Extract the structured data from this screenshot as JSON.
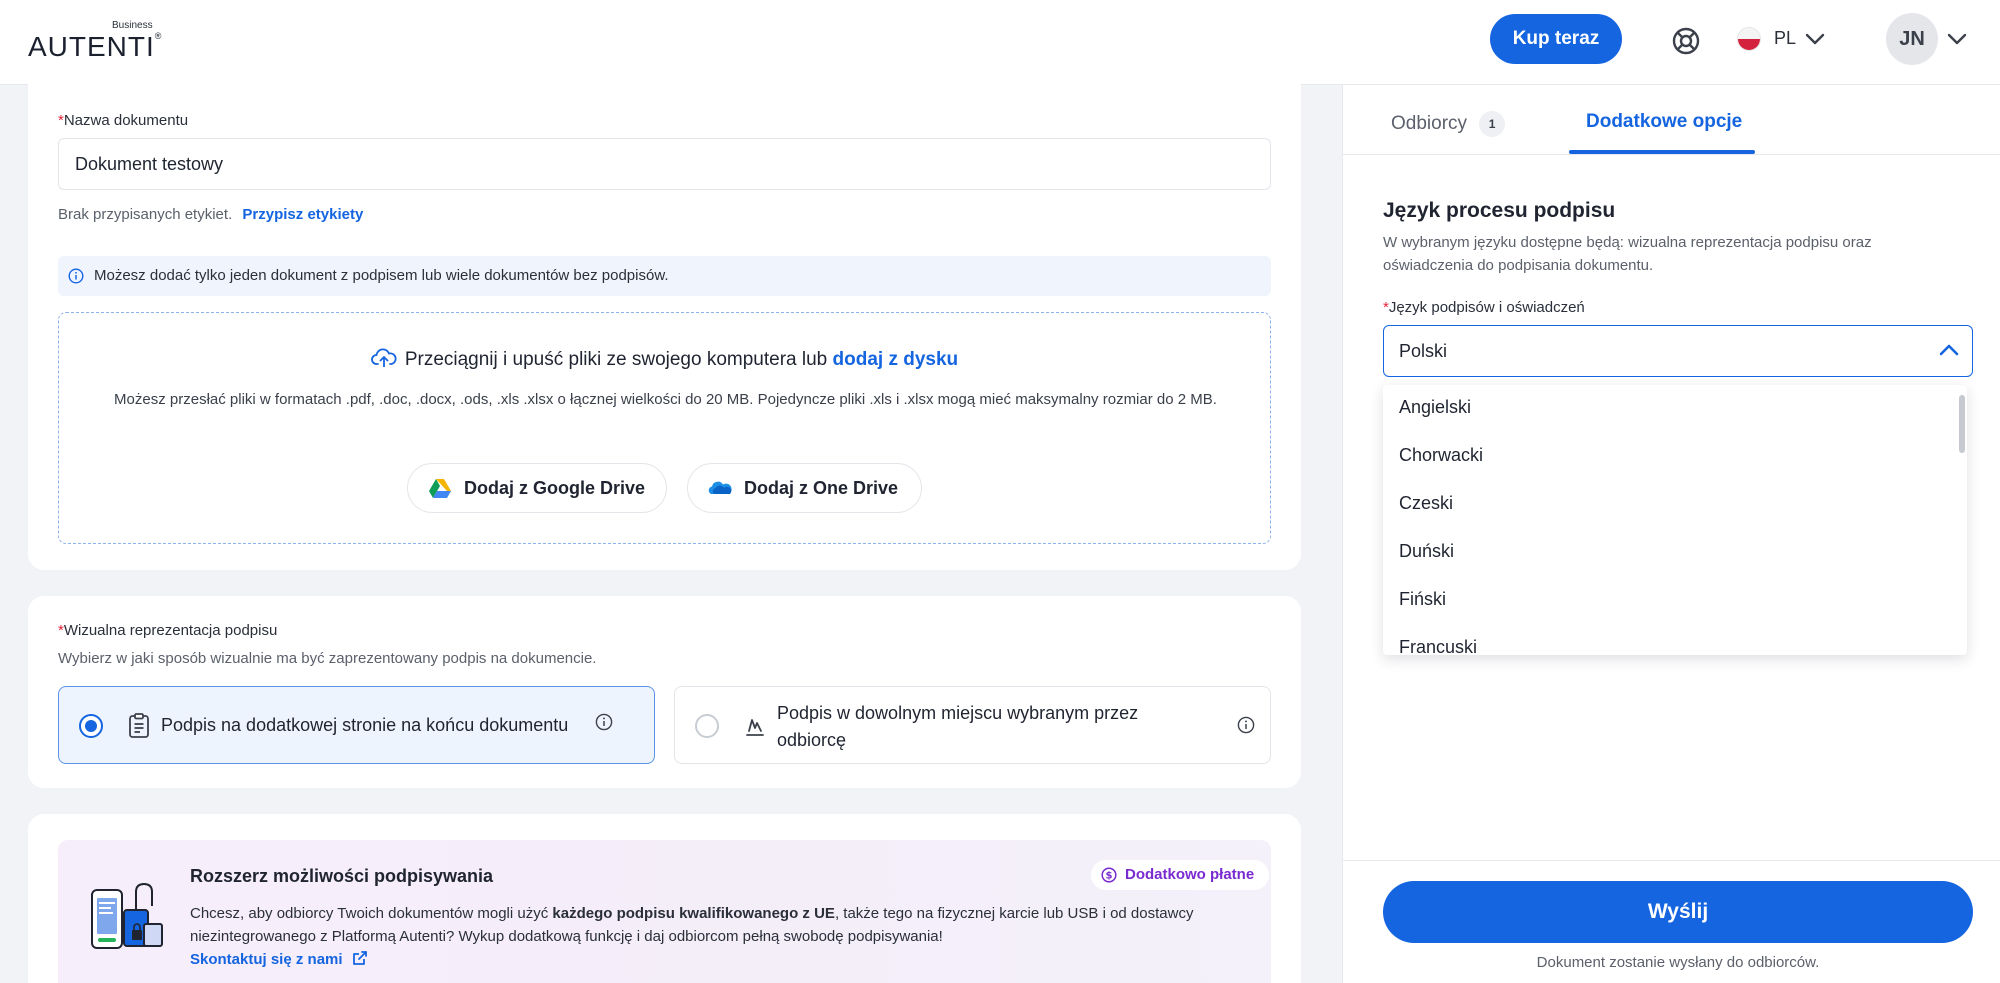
{
  "header": {
    "logo_business": "Business",
    "logo_text": "AUTENTI",
    "buy_label": "Kup teraz",
    "language": "PL",
    "user_initials": "JN"
  },
  "document": {
    "name_label": "Nazwa dokumentu",
    "name_value": "Dokument testowy",
    "no_labels_text": "Brak przypisanych etykiet.",
    "assign_labels_link": "Przypisz etykiety",
    "info_text": "Możesz dodać tylko jeden dokument z podpisem lub wiele dokumentów bez podpisów."
  },
  "upload": {
    "drag_text": "Przeciągnij i upuść pliki ze swojego komputera lub",
    "drag_link": "dodaj z dysku",
    "formats_text": "Możesz przesłać pliki w formatach .pdf, .doc, .docx, .ods, .xls .xlsx o łącznej wielkości do 20 MB. Pojedyncze pliki .xls i .xlsx mogą mieć maksymalny rozmiar do 2 MB.",
    "google_drive_label": "Dodaj z Google Drive",
    "one_drive_label": "Dodaj z One Drive"
  },
  "visual": {
    "label": "Wizualna reprezentacja podpisu",
    "description": "Wybierz w jaki sposób wizualnie ma być zaprezentowany podpis na dokumencie.",
    "option1": "Podpis na dodatkowej stronie na końcu dokumentu",
    "option2": "Podpis w dowolnym miejscu wybranym przez odbiorcę"
  },
  "promo": {
    "title": "Rozszerz możliwości podpisywania",
    "badge": "Dodatkowo płatne",
    "text_before": "Chcesz, aby odbiorcy Twoich dokumentów mogli użyć ",
    "text_bold": "każdego podpisu kwalifikowanego z UE",
    "text_after": ", także tego na fizycznej karcie lub USB i od dostawcy niezintegrowanego z Platformą Autenti? Wykup dodatkową funkcję i daj odbiorcom pełną swobodę podpisywania!",
    "link": "Skontaktuj się z nami"
  },
  "panel": {
    "tab_recipients": "Odbiorcy",
    "tab_recipients_count": "1",
    "tab_options": "Dodatkowe opcje",
    "section_title": "Język procesu podpisu",
    "section_desc": "W wybranym języku dostępne będą: wizualna reprezentacja podpisu oraz oświadczenia do podpisania dokumentu.",
    "select_label": "Język podpisów i oświadczeń",
    "select_value": "Polski",
    "options": [
      "Angielski",
      "Chorwacki",
      "Czeski",
      "Duński",
      "Fiński",
      "Francuski"
    ],
    "send_label": "Wyślij",
    "send_note": "Dokument zostanie wysłany do odbiorców."
  },
  "colors": {
    "primary": "#1565e0",
    "required": "#e0243b",
    "promo_accent": "#7a2bd0"
  }
}
